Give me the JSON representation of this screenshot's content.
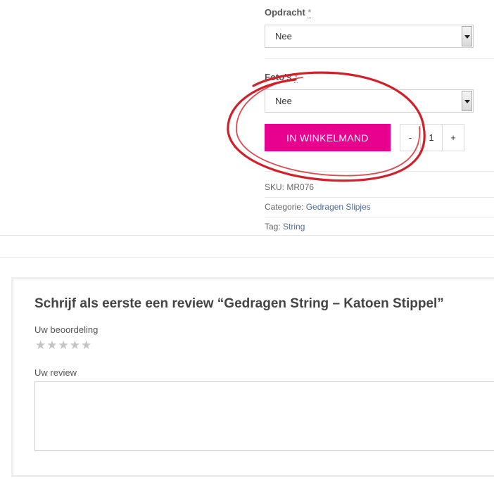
{
  "options": {
    "opdracht": {
      "label": "Opdracht",
      "required_mark": "*",
      "value": "Nee"
    },
    "fotos": {
      "label": "Foto's",
      "required_mark": "*",
      "value": "Nee"
    }
  },
  "cart": {
    "button_label": "IN WINKELMAND",
    "decrement": "-",
    "quantity": "1",
    "increment": "+"
  },
  "meta": {
    "sku_label": "SKU:",
    "sku_value": "MR076",
    "category_label": "Categorie:",
    "category_value": "Gedragen Slipjes",
    "tag_label": "Tag:",
    "tag_value": "String"
  },
  "review": {
    "title": "Schrijf als eerste een review “Gedragen String – Katoen Stippel”",
    "rating_label": "Uw beoordeling",
    "rating_value": 0,
    "rating_max": 5,
    "review_label": "Uw review",
    "review_text": ""
  },
  "annotation": {
    "color": "#d0202a"
  },
  "colors": {
    "accent": "#e8008f",
    "link": "#4e6d99"
  }
}
